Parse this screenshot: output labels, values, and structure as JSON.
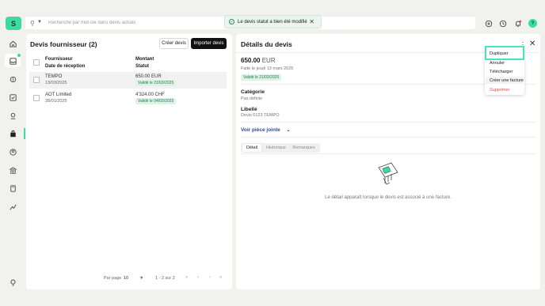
{
  "sidebar": {
    "logo": "S",
    "items": [
      {
        "icon": "home-icon"
      },
      {
        "icon": "inbox-icon"
      },
      {
        "icon": "money-icon"
      },
      {
        "icon": "checklist-icon"
      },
      {
        "icon": "hand-money-icon"
      },
      {
        "icon": "bag-icon"
      },
      {
        "icon": "user-circle-icon"
      },
      {
        "icon": "bank-icon"
      },
      {
        "icon": "calculator-icon"
      },
      {
        "icon": "chart-icon"
      }
    ],
    "bottom_icon": "lightbulb-icon"
  },
  "search": {
    "placeholder": "Recherche par mot-clé dans devis achats"
  },
  "toast": {
    "message": "Le devis statut a bien été modifié"
  },
  "topbar": {
    "avatar_letter": "?"
  },
  "list": {
    "title": "Devis fournisseur (2)",
    "create_label": "Créer devis",
    "import_label": "Importer devis",
    "headers": {
      "supplier": "Fournisseur",
      "date": "Date de réception",
      "amount": "Montant",
      "status": "Statut"
    },
    "rows": [
      {
        "supplier": "TEMPO",
        "date": "13/03/2025",
        "amount": "650.00 EUR",
        "status": "Validé le 21/03/2025"
      },
      {
        "supplier": "AOT Limited",
        "date": "28/01/2025",
        "amount": "4'324.00 CHF",
        "status": "Validé le 04/03/2025"
      }
    ],
    "pager": {
      "per_page_label": "Par page",
      "per_page_value": "10",
      "range": "1 - 2 sur 2",
      "first": "«",
      "prev": "‹",
      "next": "›",
      "last": "»"
    }
  },
  "detail": {
    "title": "Détails du devis",
    "amount_value": "650.00",
    "amount_currency": "EUR",
    "made_on": "Faite le jeudi 13 mars 2025",
    "status_badge": "Validé le 21/03/2025",
    "category_label": "Catégorie",
    "category_value": "Pas définie",
    "libelle_label": "Libellé",
    "libelle_value": "Devis 0123 TEMPO",
    "attachment_link": "Voir pièce jointe",
    "tabs": [
      "Détail",
      "Historique",
      "Remarques"
    ],
    "empty_message": "Le détail apparaît lorsque le devis est associé à une facture."
  },
  "context_menu": {
    "items": [
      "Dupliquer",
      "Annuler",
      "Télécharger",
      "Créer une facture",
      "Supprimer"
    ]
  },
  "colors": {
    "accent": "#3ddba0",
    "highlight": "#4de0c4",
    "danger": "#d9534f",
    "link": "#2a4a9a"
  }
}
